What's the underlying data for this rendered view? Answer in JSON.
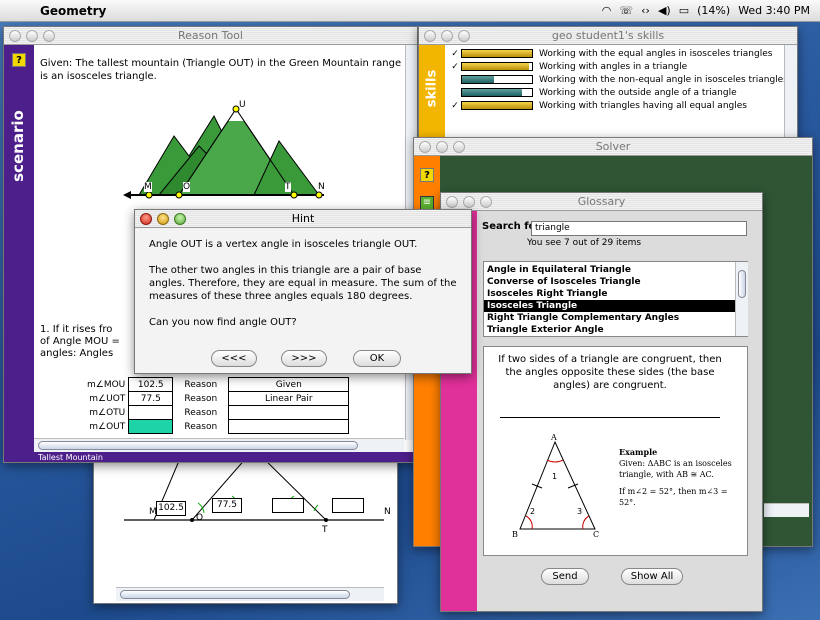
{
  "menubar": {
    "app_name": "Geometry",
    "status": "(14%)",
    "clock": "Wed 3:40 PM"
  },
  "reason_tool": {
    "title": "Reason Tool",
    "side_label": "scenario",
    "scenario_text": "Given: The tallest mountain (Triangle OUT) in the Green Mountain range is an isosceles triangle.",
    "labels": {
      "u": "U",
      "m": "M",
      "o": "O",
      "t": "T",
      "n": "N"
    },
    "question_line1": "1. If it rises fro",
    "question_line2": "of Angle MOU =",
    "question_line3": "angles: Angles",
    "rows": [
      {
        "angle": "m∠MOU",
        "value": "102.5",
        "reason_label": "Reason",
        "reason": "Given"
      },
      {
        "angle": "m∠UOT",
        "value": "77.5",
        "reason_label": "Reason",
        "reason": "Linear Pair"
      },
      {
        "angle": "m∠OTU",
        "value": "",
        "reason_label": "Reason",
        "reason": ""
      },
      {
        "angle": "m∠OUT",
        "value": "",
        "reason_label": "Reason",
        "reason": ""
      }
    ],
    "footer": "Tallest Mountain"
  },
  "diagram_window": {
    "box1": "102.5",
    "box2": "77.5",
    "m": "M",
    "o": "O",
    "t": "T",
    "n": "N"
  },
  "skills": {
    "title": "geo student1's skills",
    "side_label": "skills",
    "items": [
      {
        "label": "Working with the equal angles in isosceles triangles",
        "check": "✓",
        "level": 1.0
      },
      {
        "label": "Working with angles in a triangle",
        "check": "✓",
        "level": 0.95
      },
      {
        "label": "Working with the non-equal angle in isosceles triangles",
        "check": "",
        "level": 0.45
      },
      {
        "label": "Working with the outside angle of a triangle",
        "check": "",
        "level": 0.85
      },
      {
        "label": "Working with triangles having all equal angles",
        "check": "✓",
        "level": 1.0
      }
    ]
  },
  "solver": {
    "title": "Solver"
  },
  "hint": {
    "title": "Hint",
    "p1": "Angle OUT is a vertex angle in isosceles triangle OUT.",
    "p2": "The other two angles in this triangle are a pair of base angles. Therefore, they are equal in measure. The sum of the measures of these three angles equals 180 degrees.",
    "p3": "Can you now find angle OUT?",
    "prev_label": "<<<",
    "next_label": ">>>",
    "ok_label": "OK"
  },
  "glossary": {
    "title": "Glossary",
    "search_label": "Search for",
    "search_value": "triangle",
    "count_text": "You see 7 out of 29 items",
    "items": [
      "Angle in Equilateral Triangle",
      "Converse of Isosceles Triangle",
      "Isosceles Right Triangle",
      "Isosceles Triangle",
      "Right Triangle Complementary Angles",
      "Triangle Exterior Angle"
    ],
    "selected_index": 3,
    "definition": "If two sides of a triangle are congruent, then the angles opposite these sides (the base angles) are congruent.",
    "example_title": "Example",
    "example_given": "Given: ΔABC is an isosceles triangle, with AB ≅ AC.",
    "example_if": "If m∠2 = 52°, then m∠3 = 52°.",
    "fig": {
      "a": "A",
      "b": "B",
      "c": "C",
      "n1": "1",
      "n2": "2",
      "n3": "3"
    },
    "send_label": "Send",
    "show_all_label": "Show All"
  }
}
